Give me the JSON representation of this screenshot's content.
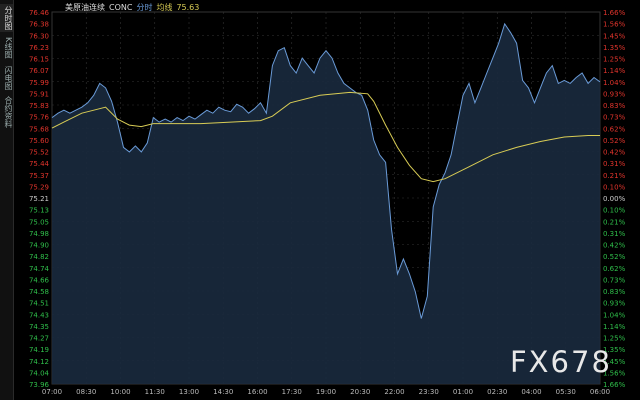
{
  "sidebar": {
    "tabs": [
      {
        "label": "分时图",
        "active": true
      },
      {
        "label": "K线图",
        "active": false
      },
      {
        "label": "闪电图",
        "active": false
      },
      {
        "label": "合约资料",
        "active": false
      }
    ]
  },
  "header": {
    "instrument": "美原油连续",
    "symbol": "CONC",
    "mode": "分时",
    "avg_label": "均线",
    "avg_value": "75.63"
  },
  "watermark": "FX678",
  "colors": {
    "background": "#000000",
    "price_line": "#6a9bd8",
    "price_fill": "#1a2a3e",
    "avg_line": "#d8cc55",
    "up": "#e0342c",
    "down": "#2fbe4a",
    "neutral": "#cccccc",
    "grid": "#333333"
  },
  "chart_data": {
    "type": "line",
    "prev_close": 75.21,
    "left_ticks": [
      "76.46",
      "76.38",
      "76.30",
      "76.23",
      "76.15",
      "76.07",
      "75.99",
      "75.91",
      "75.83",
      "75.76",
      "75.68",
      "75.60",
      "75.52",
      "75.44",
      "75.37",
      "75.29",
      "75.21",
      "75.13",
      "75.05",
      "74.98",
      "74.90",
      "74.82",
      "74.74",
      "74.66",
      "74.58",
      "74.51",
      "74.43",
      "74.35",
      "74.27",
      "74.19",
      "74.12",
      "74.04",
      "73.96"
    ],
    "right_ticks": [
      "1.66%",
      "1.56%",
      "1.45%",
      "1.35%",
      "1.25%",
      "1.14%",
      "1.04%",
      "0.93%",
      "0.83%",
      "0.73%",
      "0.62%",
      "0.52%",
      "0.42%",
      "0.31%",
      "0.21%",
      "0.10%",
      "0.00%",
      "0.10%",
      "0.21%",
      "0.31%",
      "0.42%",
      "0.52%",
      "0.62%",
      "0.73%",
      "0.83%",
      "0.93%",
      "1.04%",
      "1.14%",
      "1.25%",
      "1.35%",
      "1.45%",
      "1.56%",
      "1.66%"
    ],
    "x_ticks": [
      "07:00",
      "08:30",
      "10:00",
      "11:30",
      "13:00",
      "14:30",
      "16:00",
      "17:30",
      "19:00",
      "20:30",
      "22:00",
      "23:30",
      "01:00",
      "02:30",
      "04:00",
      "05:30",
      "06:00"
    ],
    "ylim": [
      73.96,
      76.46
    ],
    "price": [
      [
        0,
        75.75
      ],
      [
        3,
        75.78
      ],
      [
        6,
        75.8
      ],
      [
        9,
        75.78
      ],
      [
        12,
        75.8
      ],
      [
        15,
        75.82
      ],
      [
        18,
        75.85
      ],
      [
        21,
        75.9
      ],
      [
        24,
        75.98
      ],
      [
        27,
        75.95
      ],
      [
        30,
        75.86
      ],
      [
        33,
        75.72
      ],
      [
        36,
        75.55
      ],
      [
        39,
        75.52
      ],
      [
        42,
        75.56
      ],
      [
        45,
        75.52
      ],
      [
        48,
        75.58
      ],
      [
        51,
        75.75
      ],
      [
        54,
        75.72
      ],
      [
        57,
        75.74
      ],
      [
        60,
        75.72
      ],
      [
        63,
        75.75
      ],
      [
        66,
        75.73
      ],
      [
        69,
        75.76
      ],
      [
        72,
        75.74
      ],
      [
        75,
        75.77
      ],
      [
        78,
        75.8
      ],
      [
        81,
        75.78
      ],
      [
        84,
        75.82
      ],
      [
        87,
        75.8
      ],
      [
        90,
        75.79
      ],
      [
        93,
        75.84
      ],
      [
        96,
        75.82
      ],
      [
        99,
        75.78
      ],
      [
        102,
        75.81
      ],
      [
        105,
        75.85
      ],
      [
        108,
        75.78
      ],
      [
        111,
        76.1
      ],
      [
        114,
        76.2
      ],
      [
        117,
        76.22
      ],
      [
        120,
        76.1
      ],
      [
        123,
        76.05
      ],
      [
        126,
        76.15
      ],
      [
        129,
        76.1
      ],
      [
        132,
        76.05
      ],
      [
        135,
        76.15
      ],
      [
        138,
        76.2
      ],
      [
        141,
        76.15
      ],
      [
        144,
        76.05
      ],
      [
        147,
        75.98
      ],
      [
        150,
        75.95
      ],
      [
        153,
        75.92
      ],
      [
        156,
        75.9
      ],
      [
        159,
        75.8
      ],
      [
        162,
        75.6
      ],
      [
        165,
        75.5
      ],
      [
        168,
        75.45
      ],
      [
        171,
        75.0
      ],
      [
        174,
        74.7
      ],
      [
        177,
        74.8
      ],
      [
        180,
        74.7
      ],
      [
        183,
        74.58
      ],
      [
        186,
        74.4
      ],
      [
        189,
        74.55
      ],
      [
        192,
        75.15
      ],
      [
        195,
        75.3
      ],
      [
        198,
        75.38
      ],
      [
        201,
        75.5
      ],
      [
        204,
        75.7
      ],
      [
        207,
        75.9
      ],
      [
        210,
        75.98
      ],
      [
        213,
        75.85
      ],
      [
        216,
        75.95
      ],
      [
        219,
        76.05
      ],
      [
        222,
        76.15
      ],
      [
        225,
        76.25
      ],
      [
        228,
        76.38
      ],
      [
        231,
        76.32
      ],
      [
        234,
        76.25
      ],
      [
        237,
        76.0
      ],
      [
        240,
        75.95
      ],
      [
        243,
        75.85
      ],
      [
        246,
        75.95
      ],
      [
        249,
        76.05
      ],
      [
        252,
        76.1
      ],
      [
        255,
        75.98
      ],
      [
        258,
        76.0
      ],
      [
        261,
        75.98
      ],
      [
        264,
        76.02
      ],
      [
        267,
        76.05
      ],
      [
        270,
        75.98
      ],
      [
        273,
        76.02
      ],
      [
        276,
        75.99
      ]
    ],
    "avg": [
      [
        0,
        75.68
      ],
      [
        6,
        75.72
      ],
      [
        15,
        75.78
      ],
      [
        21,
        75.8
      ],
      [
        27,
        75.82
      ],
      [
        33,
        75.74
      ],
      [
        39,
        75.7
      ],
      [
        45,
        75.69
      ],
      [
        51,
        75.71
      ],
      [
        60,
        75.71
      ],
      [
        75,
        75.71
      ],
      [
        90,
        75.72
      ],
      [
        105,
        75.73
      ],
      [
        111,
        75.76
      ],
      [
        120,
        75.85
      ],
      [
        135,
        75.9
      ],
      [
        150,
        75.92
      ],
      [
        159,
        75.91
      ],
      [
        162,
        75.86
      ],
      [
        168,
        75.7
      ],
      [
        174,
        75.55
      ],
      [
        180,
        75.43
      ],
      [
        186,
        75.34
      ],
      [
        192,
        75.32
      ],
      [
        198,
        75.34
      ],
      [
        210,
        75.42
      ],
      [
        222,
        75.5
      ],
      [
        234,
        75.55
      ],
      [
        246,
        75.59
      ],
      [
        258,
        75.62
      ],
      [
        270,
        75.63
      ],
      [
        276,
        75.63
      ]
    ],
    "xlim": [
      0,
      276
    ]
  }
}
